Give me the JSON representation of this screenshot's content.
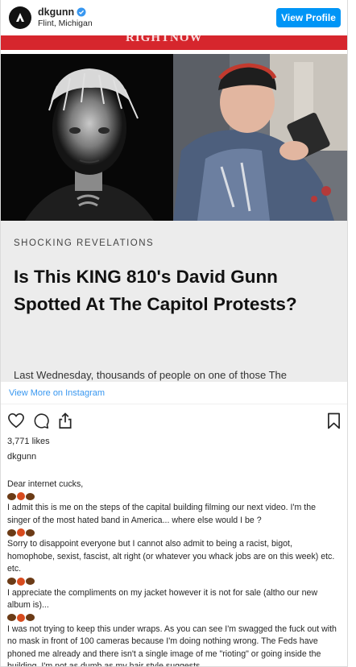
{
  "header": {
    "username": "dkgunn",
    "location": "Flint, Michigan",
    "view_profile": "View Profile"
  },
  "post": {
    "eyebrow": "SHOCKING REVELATIONS",
    "headline": "Is This KING 810's David Gunn Spotted At The Capitol Protests?",
    "cut_text": "Last Wednesday, thousands of people on one of those The"
  },
  "view_more": "View More on Instagram",
  "likes": "3,771 likes",
  "owner": "dkgunn",
  "caption": [
    {
      "kind": "text",
      "text": "Dear internet cucks,"
    },
    {
      "kind": "emoji"
    },
    {
      "kind": "text",
      "text": "I admit this is me on the steps of the capital building filming our next video. I'm the singer of the most hated band in America... where else would I be ?"
    },
    {
      "kind": "emoji"
    },
    {
      "kind": "text",
      "text": "Sorry to disappoint everyone but I cannot also admit to being a racist, bigot, homophobe, sexist, fascist, alt right (or whatever you whack jobs are on this week) etc. etc."
    },
    {
      "kind": "emoji"
    },
    {
      "kind": "text",
      "text": "I appreciate the compliments on my jacket however it is not for sale (altho our new album is)..."
    },
    {
      "kind": "emoji"
    },
    {
      "kind": "text",
      "text": "I was not trying to keep this under wraps. As you can see I'm swagged the fuck out with no mask in front of 100 cameras because I'm doing nothing wrong. The Feds have phoned me already and there isn't a single image of me \"rioting\" or going inside the building. I'm not as dumb as my hair style suggests."
    },
    {
      "kind": "emoji"
    }
  ],
  "icons": {
    "verified": "verified-badge-icon",
    "like": "heart-icon",
    "comment": "comment-icon",
    "share": "share-icon",
    "save": "bookmark-icon"
  },
  "colors": {
    "accent": "#0095f6",
    "link": "#3897f0",
    "brand_bar": "#d6262d"
  }
}
